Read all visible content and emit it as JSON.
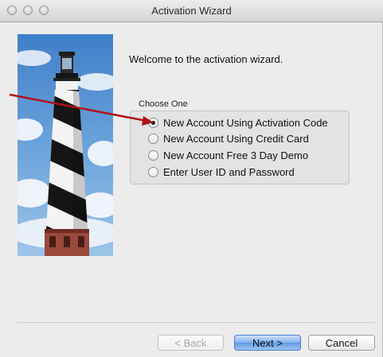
{
  "window": {
    "title": "Activation Wizard"
  },
  "content": {
    "welcome_text": "Welcome to the activation wizard.",
    "group_label": "Choose One",
    "options": [
      {
        "label": "New Account Using Activation Code",
        "checked": true
      },
      {
        "label": "New Account Using Credit Card",
        "checked": false
      },
      {
        "label": "New Account Free 3 Day Demo",
        "checked": false
      },
      {
        "label": "Enter User ID and Password",
        "checked": false
      }
    ]
  },
  "buttons": {
    "back": "< Back",
    "next": "Next >",
    "cancel": "Cancel"
  },
  "colors": {
    "annotation_arrow": "#b0121b",
    "default_button": "#6aa4e8"
  },
  "icons": {
    "hero_image": "lighthouse-image",
    "traffic_lights": "window-control-icon"
  }
}
